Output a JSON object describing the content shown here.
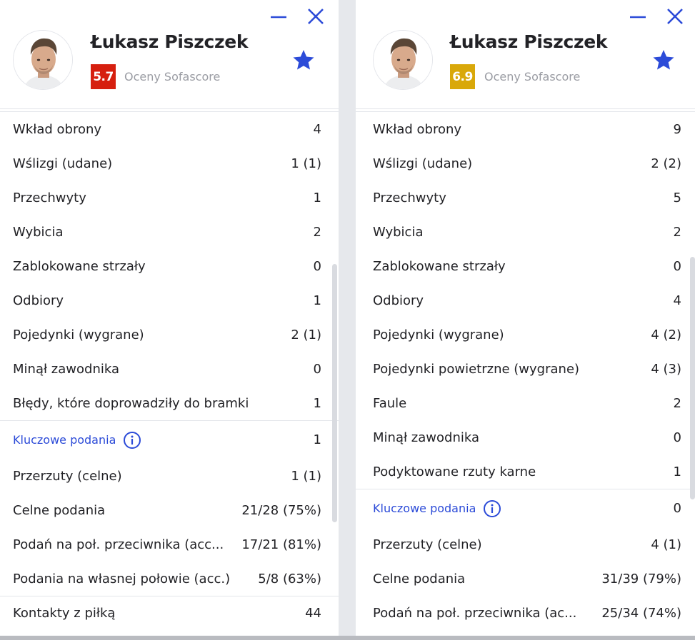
{
  "left_panel": {
    "player": {
      "name": "Łukasz Piszczek",
      "rating": "5.7",
      "rating_color": "#d61f0f",
      "rating_caption": "Oceny Sofascore"
    },
    "controls": {
      "minimize_icon": "minimize-icon",
      "close_icon": "close-icon",
      "favorite_icon": "star-icon"
    },
    "stats": [
      {
        "label": "Wkład obrony",
        "value": "4"
      },
      {
        "label": "Wślizgi (udane)",
        "value": "1 (1)"
      },
      {
        "label": "Przechwyty",
        "value": "1"
      },
      {
        "label": "Wybicia",
        "value": "2"
      },
      {
        "label": "Zablokowane strzały",
        "value": "0"
      },
      {
        "label": "Odbiory",
        "value": "1"
      },
      {
        "label": "Pojedynki (wygrane)",
        "value": "2 (1)"
      },
      {
        "label": "Minął zawodnika",
        "value": "0"
      },
      {
        "label": "Błędy, które doprowadziły do bramki",
        "value": "1"
      }
    ],
    "key_passes": {
      "label": "Kluczowe podania",
      "value": "1",
      "icon": "info-icon"
    },
    "passing": [
      {
        "label": "Przerzuty (celne)",
        "value": "1 (1)"
      },
      {
        "label": "Celne podania",
        "value": "21/28 (75%)"
      },
      {
        "label": "Podań na poł. przeciwnika (acc...",
        "value": "17/21 (81%)"
      },
      {
        "label": "Podania na własnej połowie (acc.)",
        "value": "5/8 (63%)"
      }
    ],
    "touches": {
      "label": "Kontakty z piłką",
      "value": "44"
    }
  },
  "right_panel": {
    "player": {
      "name": "Łukasz Piszczek",
      "rating": "6.9",
      "rating_color": "#d9a80a",
      "rating_caption": "Oceny Sofascore"
    },
    "controls": {
      "minimize_icon": "minimize-icon",
      "close_icon": "close-icon",
      "favorite_icon": "star-icon"
    },
    "stats": [
      {
        "label": "Wkład obrony",
        "value": "9"
      },
      {
        "label": "Wślizgi (udane)",
        "value": "2 (2)"
      },
      {
        "label": "Przechwyty",
        "value": "5"
      },
      {
        "label": "Wybicia",
        "value": "2"
      },
      {
        "label": "Zablokowane strzały",
        "value": "0"
      },
      {
        "label": "Odbiory",
        "value": "4"
      },
      {
        "label": "Pojedynki (wygrane)",
        "value": "4 (2)"
      },
      {
        "label": "Pojedynki powietrzne (wygrane)",
        "value": "4 (3)"
      },
      {
        "label": "Faule",
        "value": "2"
      },
      {
        "label": "Minął zawodnika",
        "value": "0"
      },
      {
        "label": "Podyktowane rzuty karne",
        "value": "1"
      }
    ],
    "key_passes": {
      "label": "Kluczowe podania",
      "value": "0",
      "icon": "info-icon"
    },
    "passing": [
      {
        "label": "Przerzuty (celne)",
        "value": "4 (1)"
      },
      {
        "label": "Celne podania",
        "value": "31/39 (79%)"
      },
      {
        "label": "Podań na poł. przeciwnika (ac...",
        "value": "25/34 (74%)"
      }
    ]
  },
  "colors": {
    "accent": "#2c4bd8",
    "text": "#222226",
    "muted": "#9a9ca3",
    "divider": "#e3e5ea"
  }
}
